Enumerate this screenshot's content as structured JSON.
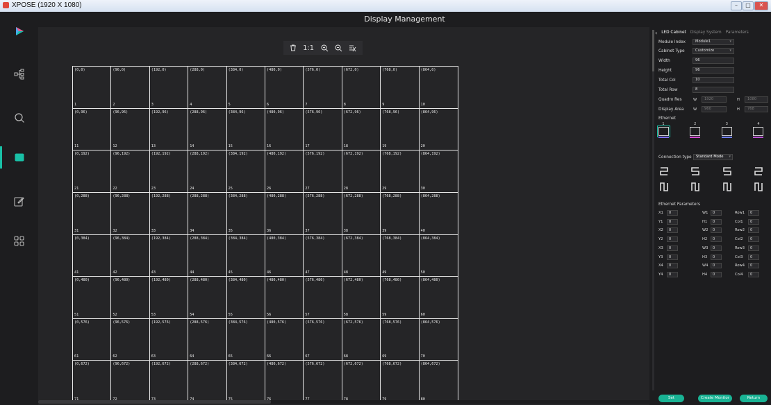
{
  "window": {
    "title": "XPOSE (1920 X 1080)",
    "minimize": "–",
    "maximize": "□",
    "close": "✕"
  },
  "header": {
    "title": "Display Management"
  },
  "sidebar": [
    {
      "icon": "play-logo-icon"
    },
    {
      "icon": "topology-icon"
    },
    {
      "icon": "search-icon"
    },
    {
      "icon": "display-icon",
      "active": true
    },
    {
      "icon": "edit-icon"
    },
    {
      "icon": "grid-apps-icon"
    }
  ],
  "toolbar": {
    "ratio": "1:1"
  },
  "grid": {
    "cols": 10,
    "rows": 8,
    "cells": [
      {
        "coord": "(0,0)",
        "num": "1"
      },
      {
        "coord": "(96,0)",
        "num": "2"
      },
      {
        "coord": "(192,0)",
        "num": "3"
      },
      {
        "coord": "(288,0)",
        "num": "4"
      },
      {
        "coord": "(384,0)",
        "num": "5"
      },
      {
        "coord": "(480,0)",
        "num": "6"
      },
      {
        "coord": "(576,0)",
        "num": "7"
      },
      {
        "coord": "(672,0)",
        "num": "8"
      },
      {
        "coord": "(768,0)",
        "num": "9"
      },
      {
        "coord": "(864,0)",
        "num": "10"
      },
      {
        "coord": "(0,96)",
        "num": "11"
      },
      {
        "coord": "(96,96)",
        "num": "12"
      },
      {
        "coord": "(192,96)",
        "num": "13"
      },
      {
        "coord": "(288,96)",
        "num": "14"
      },
      {
        "coord": "(384,96)",
        "num": "15"
      },
      {
        "coord": "(480,96)",
        "num": "16"
      },
      {
        "coord": "(576,96)",
        "num": "17"
      },
      {
        "coord": "(672,96)",
        "num": "18"
      },
      {
        "coord": "(768,96)",
        "num": "19"
      },
      {
        "coord": "(864,96)",
        "num": "20"
      },
      {
        "coord": "(0,192)",
        "num": "21"
      },
      {
        "coord": "(96,192)",
        "num": "22"
      },
      {
        "coord": "(192,192)",
        "num": "23"
      },
      {
        "coord": "(288,192)",
        "num": "24"
      },
      {
        "coord": "(384,192)",
        "num": "25"
      },
      {
        "coord": "(480,192)",
        "num": "26"
      },
      {
        "coord": "(576,192)",
        "num": "27"
      },
      {
        "coord": "(672,192)",
        "num": "28"
      },
      {
        "coord": "(768,192)",
        "num": "29"
      },
      {
        "coord": "(864,192)",
        "num": "30"
      },
      {
        "coord": "(0,288)",
        "num": "31"
      },
      {
        "coord": "(96,288)",
        "num": "32"
      },
      {
        "coord": "(192,288)",
        "num": "33"
      },
      {
        "coord": "(288,288)",
        "num": "34"
      },
      {
        "coord": "(384,288)",
        "num": "35"
      },
      {
        "coord": "(480,288)",
        "num": "36"
      },
      {
        "coord": "(576,288)",
        "num": "37"
      },
      {
        "coord": "(672,288)",
        "num": "38"
      },
      {
        "coord": "(768,288)",
        "num": "39"
      },
      {
        "coord": "(864,288)",
        "num": "40"
      },
      {
        "coord": "(0,384)",
        "num": "41"
      },
      {
        "coord": "(96,384)",
        "num": "42"
      },
      {
        "coord": "(192,384)",
        "num": "43"
      },
      {
        "coord": "(288,384)",
        "num": "44"
      },
      {
        "coord": "(384,384)",
        "num": "45"
      },
      {
        "coord": "(480,384)",
        "num": "46"
      },
      {
        "coord": "(576,384)",
        "num": "47"
      },
      {
        "coord": "(672,384)",
        "num": "48"
      },
      {
        "coord": "(768,384)",
        "num": "49"
      },
      {
        "coord": "(864,384)",
        "num": "50"
      },
      {
        "coord": "(0,480)",
        "num": "51"
      },
      {
        "coord": "(96,480)",
        "num": "52"
      },
      {
        "coord": "(192,480)",
        "num": "53"
      },
      {
        "coord": "(288,480)",
        "num": "54"
      },
      {
        "coord": "(384,480)",
        "num": "55"
      },
      {
        "coord": "(480,480)",
        "num": "56"
      },
      {
        "coord": "(576,480)",
        "num": "57"
      },
      {
        "coord": "(672,480)",
        "num": "58"
      },
      {
        "coord": "(768,480)",
        "num": "59"
      },
      {
        "coord": "(864,480)",
        "num": "60"
      },
      {
        "coord": "(0,576)",
        "num": "61"
      },
      {
        "coord": "(96,576)",
        "num": "62"
      },
      {
        "coord": "(192,576)",
        "num": "63"
      },
      {
        "coord": "(288,576)",
        "num": "64"
      },
      {
        "coord": "(384,576)",
        "num": "65"
      },
      {
        "coord": "(480,576)",
        "num": "66"
      },
      {
        "coord": "(576,576)",
        "num": "67"
      },
      {
        "coord": "(672,576)",
        "num": "68"
      },
      {
        "coord": "(768,576)",
        "num": "69"
      },
      {
        "coord": "(864,576)",
        "num": "70"
      },
      {
        "coord": "(0,672)",
        "num": "71"
      },
      {
        "coord": "(96,672)",
        "num": "72"
      },
      {
        "coord": "(192,672)",
        "num": "73"
      },
      {
        "coord": "(288,672)",
        "num": "74"
      },
      {
        "coord": "(384,672)",
        "num": "75"
      },
      {
        "coord": "(480,672)",
        "num": "76"
      },
      {
        "coord": "(576,672)",
        "num": "77"
      },
      {
        "coord": "(672,672)",
        "num": "78"
      },
      {
        "coord": "(768,672)",
        "num": "79"
      },
      {
        "coord": "(864,672)",
        "num": "80"
      }
    ]
  },
  "panel": {
    "tabs": [
      "LED Cabinet",
      "Display System",
      "Parameters"
    ],
    "module_index": {
      "label": "Module Index",
      "value": "Module1"
    },
    "cabinet_type": {
      "label": "Cabinet Type",
      "value": "Customize"
    },
    "width": {
      "label": "Width",
      "value": "96"
    },
    "height": {
      "label": "Height",
      "value": "96"
    },
    "total_col": {
      "label": "Total  Col",
      "value": "10"
    },
    "total_row": {
      "label": "Total Row",
      "value": "8"
    },
    "quadro_res": {
      "label": "Quadro Res",
      "w_label": "W",
      "w": "1920",
      "h_label": "H",
      "h": "1080"
    },
    "display_area": {
      "label": "Display Area",
      "w_label": "W",
      "w": "960",
      "h_label": "H",
      "h": "768"
    },
    "ethernet_label": "Ethernet",
    "ports": [
      {
        "num": "1",
        "color": "#7b6cf0",
        "selected": true
      },
      {
        "num": "2",
        "color": "#d14bd0"
      },
      {
        "num": "3",
        "color": "#6d7cf0"
      },
      {
        "num": "4",
        "color": "#b94fd0"
      }
    ],
    "connection": {
      "label": "Connection type",
      "value": "Standard Mode"
    },
    "eth_params_label": "Ethernet Parameters",
    "eth_params": [
      {
        "a": "X1",
        "av": "0",
        "b": "W1",
        "bv": "0",
        "c": "Row1",
        "cv": "0"
      },
      {
        "a": "Y1",
        "av": "0",
        "b": "H1",
        "bv": "0",
        "c": "Col1",
        "cv": "0"
      },
      {
        "a": "X2",
        "av": "0",
        "b": "W2",
        "bv": "0",
        "c": "Row2",
        "cv": "0"
      },
      {
        "a": "Y2",
        "av": "0",
        "b": "H2",
        "bv": "0",
        "c": "Col2",
        "cv": "0"
      },
      {
        "a": "X3",
        "av": "0",
        "b": "W3",
        "bv": "0",
        "c": "Row3",
        "cv": "0"
      },
      {
        "a": "Y3",
        "av": "0",
        "b": "H3",
        "bv": "0",
        "c": "Col3",
        "cv": "0"
      },
      {
        "a": "X4",
        "av": "0",
        "b": "W4",
        "bv": "0",
        "c": "Row4",
        "cv": "0"
      },
      {
        "a": "Y4",
        "av": "0",
        "b": "H4",
        "bv": "0",
        "c": "Col4",
        "cv": "0"
      }
    ],
    "buttons": {
      "set": "Set",
      "create_monitor": "Create Monitor",
      "return": "Return"
    }
  },
  "colors": {
    "accent": "#19c0a6",
    "button": "#19b394"
  }
}
